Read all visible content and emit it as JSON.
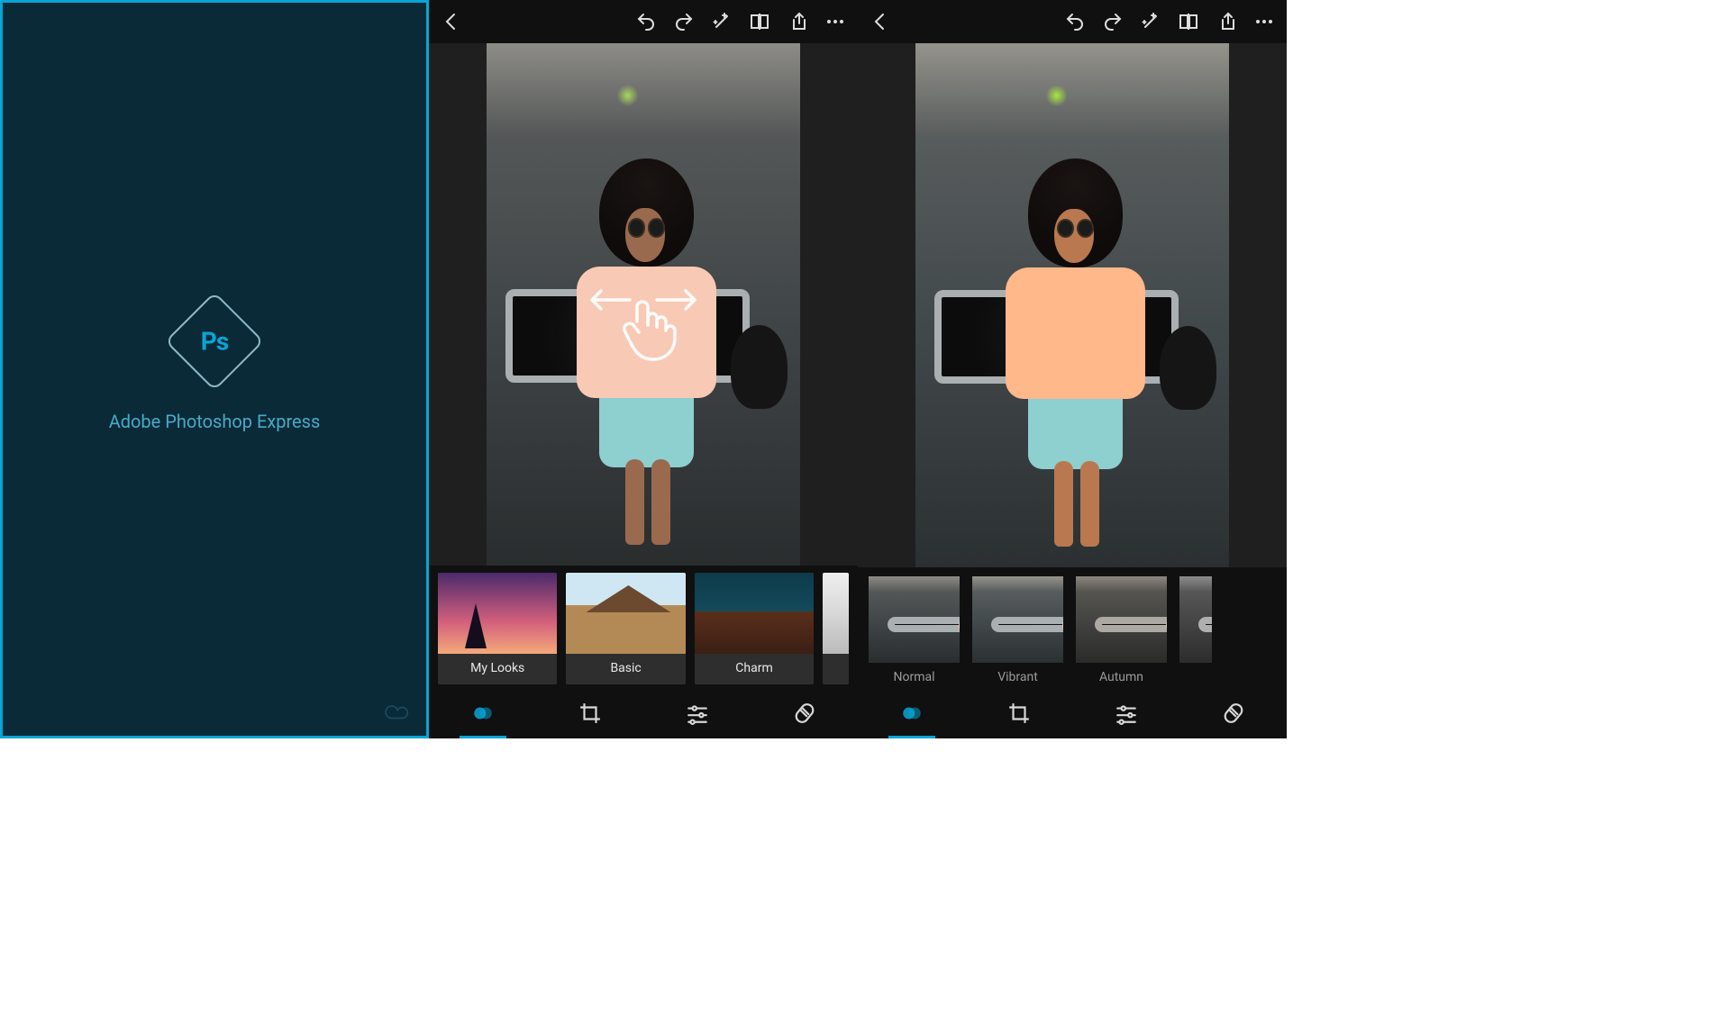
{
  "splash": {
    "logo_letters": "Ps",
    "title": "Adobe Photoshop Express"
  },
  "editor_a": {
    "categories": [
      {
        "id": "my-looks",
        "label": "My Looks"
      },
      {
        "id": "basic",
        "label": "Basic"
      },
      {
        "id": "charm",
        "label": "Charm"
      }
    ]
  },
  "editor_b": {
    "filters": [
      {
        "id": "normal",
        "label": "Normal",
        "selected": false
      },
      {
        "id": "vibrant",
        "label": "Vibrant",
        "selected": false
      },
      {
        "id": "autumn",
        "label": "Autumn",
        "selected": false
      }
    ]
  },
  "icons": {
    "back": "back-icon",
    "undo": "undo-icon",
    "redo": "redo-icon",
    "magic": "magic-wand-icon",
    "compare": "compare-icon",
    "share": "share-icon",
    "more": "more-icon",
    "looks": "looks-icon",
    "crop": "crop-icon",
    "adjust": "sliders-icon",
    "heal": "heal-icon",
    "cc": "creative-cloud-icon",
    "swipe": "swipe-hint-icon"
  },
  "colors": {
    "accent": "#08a5d6",
    "splash_bg": "#0a2a38",
    "bar_bg": "#101010"
  }
}
